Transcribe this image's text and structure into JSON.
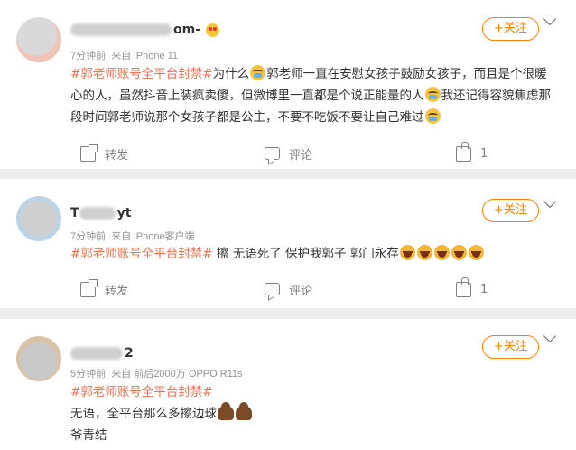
{
  "colors": {
    "hashtag": "#eb7350",
    "follow": "#ff8200",
    "meta": "#939393",
    "background": "#ededed"
  },
  "posts": [
    {
      "username_visible": "om-",
      "username_emoji": "heart-eyes-emoji",
      "time": "7分钟前",
      "source": "来自 iPhone 11",
      "hashtag": "#郭老师账号全平台封禁#",
      "text_segments": [
        "为什么",
        "郭老师一直在安慰女孩子鼓励女孩子，而且是个很暖心的人，虽然抖音上装疯卖傻，但微博里一直都是个说正能量的人",
        "我还记得容貌焦虑那段时间郭老师说那个女孩子都是公主，不要不吃饭不要让自己难过"
      ],
      "follow_label": "+关注",
      "forward_label": "转发",
      "comment_label": "评论",
      "like_count": "1"
    },
    {
      "username_visible_start": "T",
      "username_visible_end": "yt",
      "time": "7分钟前",
      "source": "来自 iPhone客户端",
      "hashtag": "#郭老师账号全平台封禁#",
      "text": " 擦 无语死了 保护我郭子 郭门永存",
      "emojis": [
        "angry-emoji",
        "angry-emoji",
        "angry-emoji",
        "angry-emoji",
        "angry-emoji"
      ],
      "follow_label": "+关注",
      "forward_label": "转发",
      "comment_label": "评论",
      "like_count": "1"
    },
    {
      "username_visible": "2",
      "time": "5分钟前",
      "source": "来自 前后2000万 OPPO R11s",
      "hashtag": "#郭老师账号全平台封禁#",
      "line2": "无语，全平台那么多擦边球",
      "line3": "爷青结",
      "emojis": [
        "poop-emoji",
        "poop-emoji"
      ],
      "follow_label": "+关注"
    }
  ]
}
